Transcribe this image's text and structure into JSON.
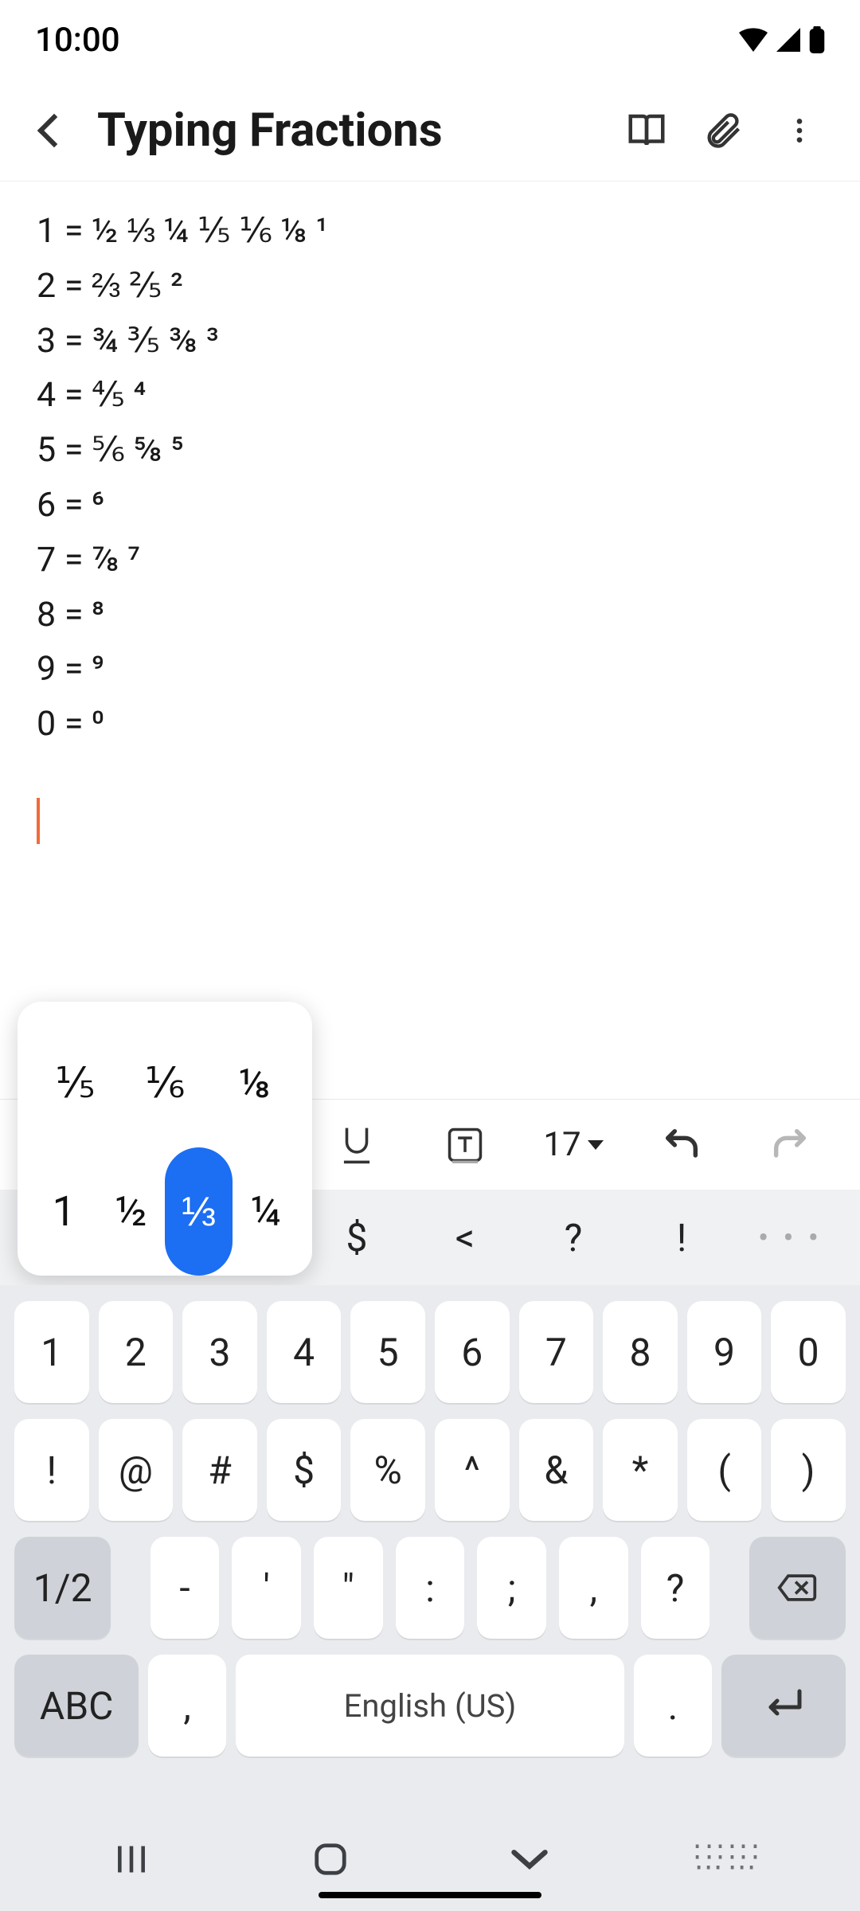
{
  "status": {
    "time": "10:00"
  },
  "header": {
    "title": "Typing Fractions"
  },
  "doc_lines": [
    "1 = ½ ⅓ ¼ ⅕ ⅙ ⅛ ¹",
    "2 = ⅔ ⅖ ²",
    "3 = ¾ ⅗ ⅜ ³",
    "4 = ⅘ ⁴",
    "5 = ⅚ ⅝ ⁵",
    "6 = ⁶",
    "7 = ⅞ ⁷",
    "8 = ⁸",
    "9 = ⁹",
    "0 = ⁰"
  ],
  "toolbar": {
    "font_size": "17"
  },
  "suggestions": {
    "items": [
      "$",
      "<",
      "?",
      "!"
    ],
    "more": "• • •"
  },
  "popup": {
    "row1": [
      "⅕",
      "⅙",
      "⅛"
    ],
    "row2": [
      "1",
      "½",
      "⅓",
      "¼"
    ],
    "selected_index": 2
  },
  "keyboard": {
    "row1": [
      "1",
      "2",
      "3",
      "4",
      "5",
      "6",
      "7",
      "8",
      "9",
      "0"
    ],
    "row2": [
      "!",
      "@",
      "#",
      "$",
      "%",
      "^",
      "&",
      "*",
      "(",
      ")"
    ],
    "row3_shift": "1/2",
    "row3": [
      "-",
      "'",
      "\"",
      ":",
      ";",
      ",",
      "?"
    ],
    "row4_abc": "ABC",
    "row4_comma": ",",
    "row4_space": "English (US)",
    "row4_period": "."
  }
}
